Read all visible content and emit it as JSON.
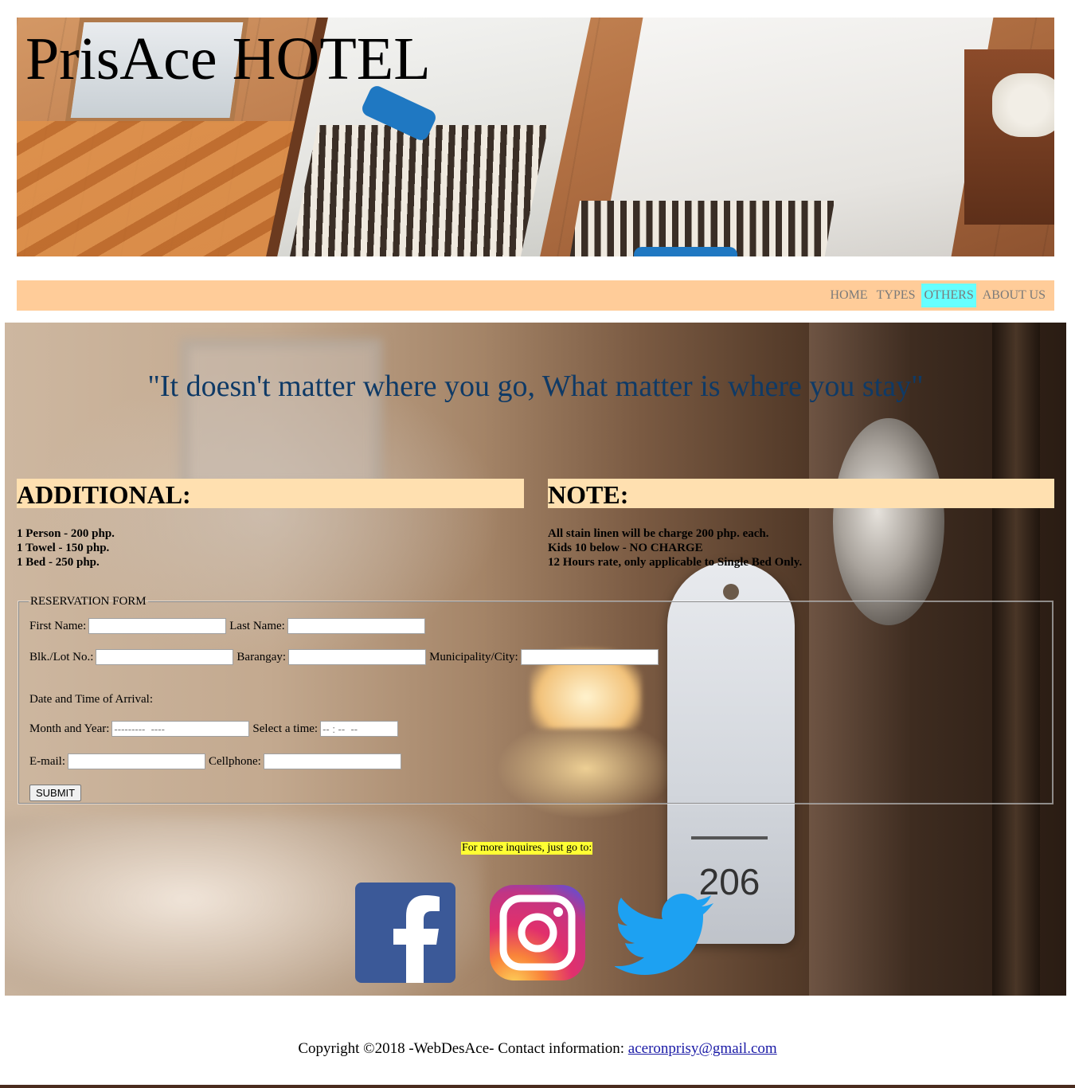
{
  "header": {
    "title": "PrisAce HOTEL"
  },
  "nav": {
    "items": [
      {
        "label": "HOME"
      },
      {
        "label": "TYPES"
      },
      {
        "label": "OTHERS"
      },
      {
        "label": "ABOUT US"
      }
    ],
    "active": "OTHERS",
    "background_color": "#ffcc99",
    "active_color": "#66ffff"
  },
  "main": {
    "quote": "\"It doesn't matter where you go, What matter is where you stay\"",
    "quote_color": "#0f3a66",
    "room_tag_number": "206",
    "additional": {
      "heading": "ADDITIONAL:",
      "items": [
        "1 Person - 200 php.",
        "1 Towel - 150 php.",
        "1 Bed - 250 php."
      ]
    },
    "note": {
      "heading": "NOTE:",
      "items": [
        "All stain linen will be charge 200 php. each.",
        "Kids 10 below - NO CHARGE",
        "12 Hours rate, only applicable to Single Bed Only."
      ]
    },
    "section_head_color": "#ffe0b0"
  },
  "form": {
    "legend": "RESERVATION FORM",
    "first_name_label": "First Name:",
    "first_name_value": "",
    "last_name_label": "Last Name:",
    "last_name_value": "",
    "blk_label": "Blk./Lot No.:",
    "blk_value": "",
    "barangay_label": "Barangay:",
    "barangay_value": "",
    "city_label": "Municipality/City:",
    "city_value": "",
    "arrival_label": "Date and Time of Arrival:",
    "month_label": "Month and Year:",
    "month_placeholder": "---------  ----",
    "time_label": "Select a time:",
    "time_placeholder": "-- : --  --",
    "email_label": "E-mail:",
    "email_value": "",
    "cell_label": "Cellphone:",
    "cell_value": "",
    "submit_label": "SUBMIT"
  },
  "inquiry": {
    "text": "For more inquires, just go to:",
    "highlight_color": "#ffff33"
  },
  "social": [
    {
      "name": "facebook-icon",
      "color": "#3b5998"
    },
    {
      "name": "instagram-icon",
      "color": "#e1306c"
    },
    {
      "name": "twitter-icon",
      "color": "#1da1f2"
    }
  ],
  "footer": {
    "text": "Copyright ©2018 -WebDesAce- Contact information: ",
    "email": "aceronprisy@gmail.com"
  }
}
